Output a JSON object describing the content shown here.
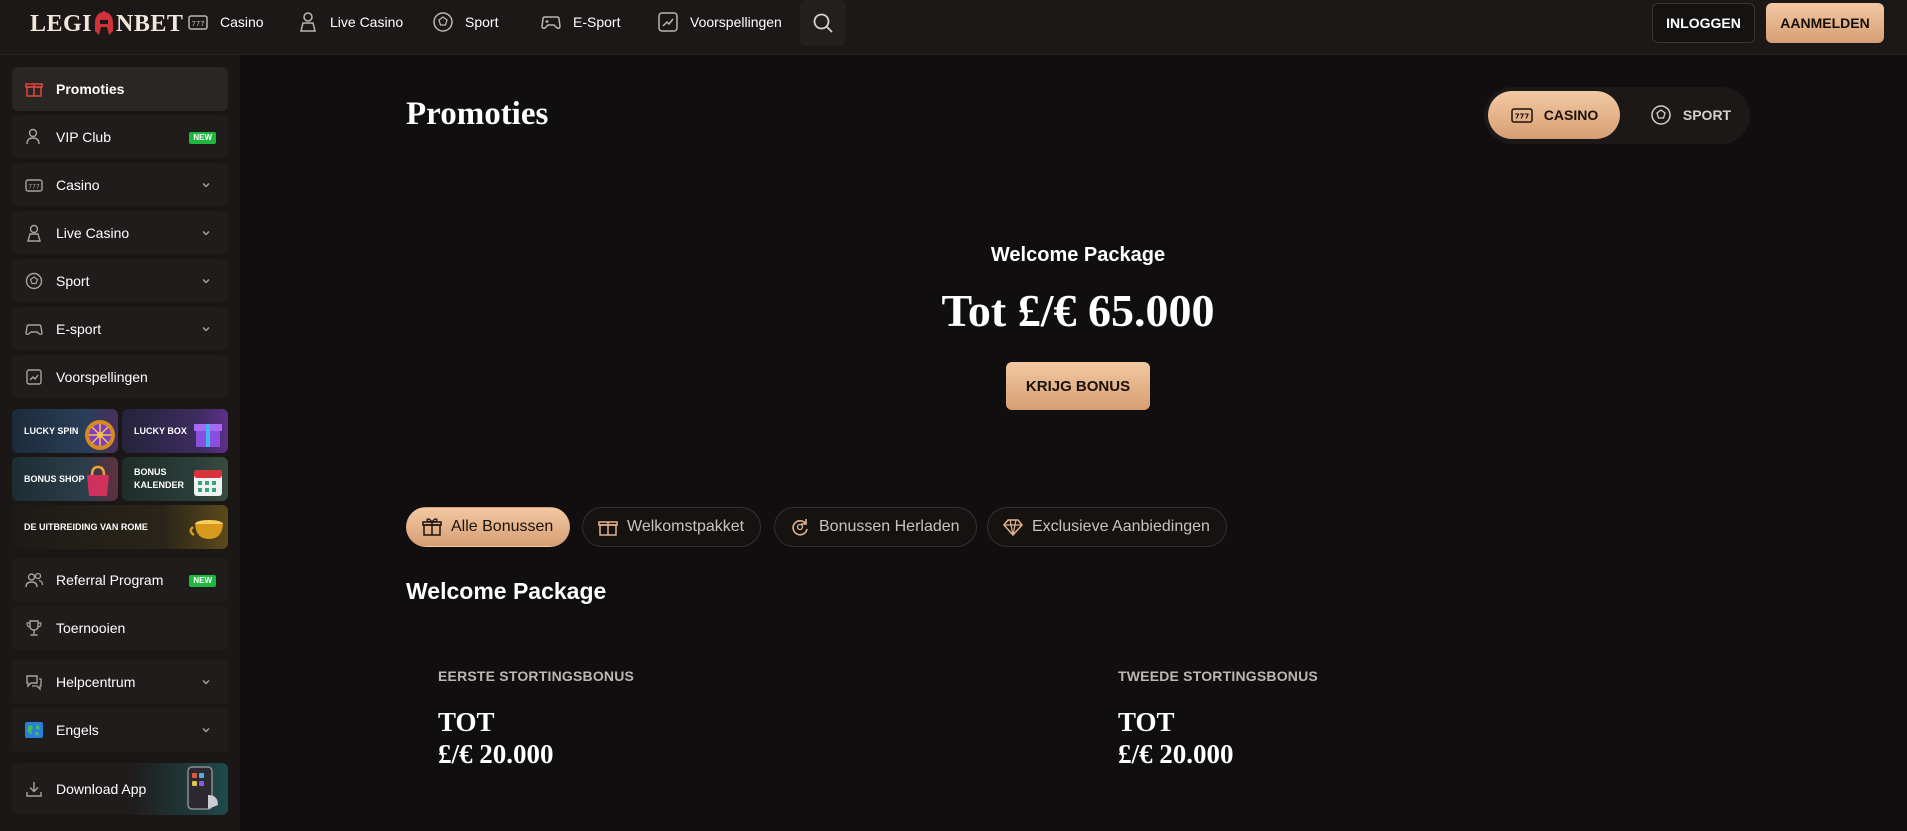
{
  "header": {
    "logo": {
      "part1": "LEGI",
      "part2": "NBET"
    },
    "nav": [
      {
        "label": "Casino",
        "icon": "slot-machine-icon"
      },
      {
        "label": "Live Casino",
        "icon": "dealer-icon"
      },
      {
        "label": "Sport",
        "icon": "soccer-ball-icon"
      },
      {
        "label": "E-Sport",
        "icon": "gamepad-icon"
      },
      {
        "label": "Voorspellingen",
        "icon": "trend-chart-icon"
      }
    ],
    "login_label": "INLOGGEN",
    "register_label": "AANMELDEN"
  },
  "sidebar": {
    "items": [
      {
        "label": "Promoties",
        "icon": "gift-icon",
        "active": true
      },
      {
        "label": "VIP Club",
        "icon": "vip-user-icon",
        "badge": "NEW"
      },
      {
        "label": "Casino",
        "icon": "slot-machine-icon"
      },
      {
        "label": "Live Casino",
        "icon": "dealer-icon"
      },
      {
        "label": "Sport",
        "icon": "soccer-ball-icon"
      },
      {
        "label": "E-sport",
        "icon": "gamepad-icon"
      },
      {
        "label": "Voorspellingen",
        "icon": "trend-chart-icon"
      }
    ],
    "tiles": [
      {
        "label": "LUCKY SPIN"
      },
      {
        "label": "LUCKY BOX"
      },
      {
        "label": "BONUS SHOP"
      },
      {
        "label": "BONUS KALENDER"
      },
      {
        "label": "DE UITBREIDING VAN ROME"
      }
    ],
    "items2": [
      {
        "label": "Referral Program",
        "icon": "users-icon",
        "badge": "NEW"
      },
      {
        "label": "Toernooien",
        "icon": "trophy-icon"
      },
      {
        "label": "Helpcentrum",
        "icon": "chat-icon"
      },
      {
        "label": "Engels",
        "icon": "globe-flag-icon"
      },
      {
        "label": "Download App",
        "icon": "download-icon"
      }
    ]
  },
  "main": {
    "title": "Promoties",
    "toggle": {
      "casino": "CASINO",
      "sport": "SPORT"
    },
    "hero": {
      "subtitle": "Welcome Package",
      "headline": "Tot £/€ 65.000",
      "button": "KRIJG BONUS"
    },
    "filters": [
      {
        "label": "Alle Bonussen",
        "icon": "gift-icon",
        "active": true
      },
      {
        "label": "Welkomstpakket",
        "icon": "gift-box-icon"
      },
      {
        "label": "Bonussen Herladen",
        "icon": "reload-icon"
      },
      {
        "label": "Exclusieve Aanbiedingen",
        "icon": "diamond-icon"
      }
    ],
    "section_title": "Welcome Package",
    "cards": [
      {
        "label": "EERSTE STORTINGSBONUS",
        "line1": "TOT",
        "line2": "£/€ 20.000"
      },
      {
        "label": "TWEEDE STORTINGSBONUS",
        "line1": "TOT",
        "line2": "£/€ 20.000"
      }
    ]
  },
  "colors": {
    "accent": "#e6b28a",
    "background": "#100e0e",
    "sidebar": "#1a1716",
    "badge": "#1fb83e",
    "logo_red": "#d0323b"
  }
}
